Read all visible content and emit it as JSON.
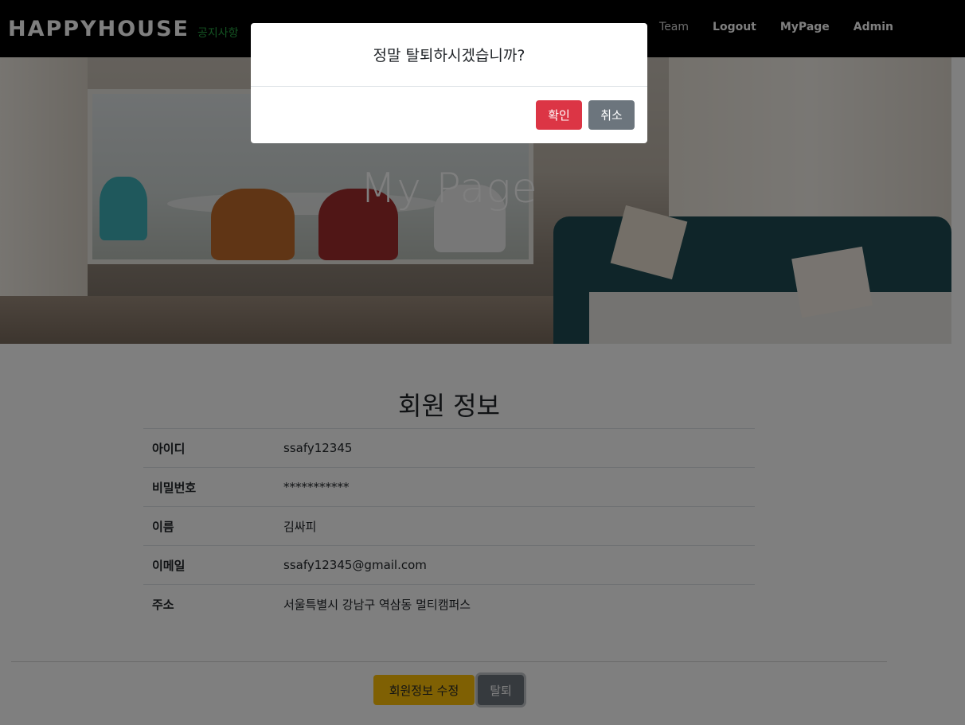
{
  "navbar": {
    "brand": "HAPPYHOUSE",
    "brand_sub": "공지사항",
    "links": [
      {
        "label": "Team"
      },
      {
        "label": "Logout"
      },
      {
        "label": "MyPage"
      },
      {
        "label": "Admin"
      }
    ]
  },
  "hero": {
    "title": "My Page"
  },
  "profile": {
    "title": "회원 정보",
    "rows": [
      {
        "label": "아이디",
        "value": "ssafy12345"
      },
      {
        "label": "비밀번호",
        "value": "***********"
      },
      {
        "label": "이름",
        "value": "김싸피"
      },
      {
        "label": "이메일",
        "value": "ssafy12345@gmail.com"
      },
      {
        "label": "주소",
        "value": "서울특별시 강남구 역삼동 멀티캠퍼스"
      }
    ],
    "edit_button": "회원정보 수정",
    "withdraw_button": "탈퇴"
  },
  "modal": {
    "message": "정말 탈퇴하시겠습니까?",
    "confirm_label": "확인",
    "cancel_label": "취소"
  },
  "colors": {
    "navbar_bg": "#000000",
    "brand_sub": "#28a745",
    "edit_button": "#ffc107",
    "withdraw_button": "#6c757d",
    "confirm_button": "#dc3545",
    "cancel_button": "#6c757d"
  }
}
